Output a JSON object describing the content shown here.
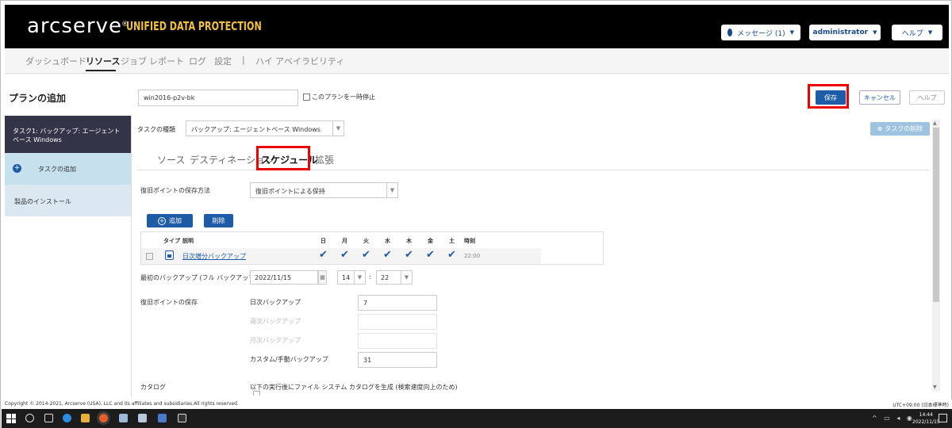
{
  "header": {
    "logo": "arcserve",
    "logo_mark": "®",
    "product": "UNIFIED DATA PROTECTION",
    "messages_label": "メッセージ (1)",
    "user_label": "administrator",
    "help_label": "ヘルプ"
  },
  "nav": {
    "items": [
      "ダッシュボード",
      "リソース",
      "ジョブ",
      "レポート",
      "ログ",
      "設定",
      "|",
      "ハイ アベイラビリティ"
    ]
  },
  "plan": {
    "title": "プランの追加",
    "name_value": "win2016-p2v-bk",
    "pause_label": "このプランを一時停止",
    "save_label": "保存",
    "cancel_label": "キャンセル",
    "help_label": "ヘルプ"
  },
  "sidebar": {
    "task_label": "タスク1: バックアップ: エージェントベース Windows",
    "add_task_label": "タスクの追加",
    "install_label": "製品のインストール"
  },
  "task_type": {
    "label": "タスクの種類",
    "value": "バックアップ: エージェントベース Windows",
    "delete_label": "タスクの削除"
  },
  "tabs": [
    "ソース",
    "デスティネーション",
    "スケジュール",
    "拡張"
  ],
  "form": {
    "retention_method_label": "復旧ポイントの保存方法",
    "retention_method_value": "復旧ポイントによる保持",
    "add_label": "追加",
    "delete_label": "削除",
    "first_backup_label": "最初のバックアップ (フル バックアップ)",
    "first_backup_date": "2022/11/15",
    "first_backup_hour": "14",
    "time_separator": ":",
    "first_backup_minute": "22",
    "retention_label": "復旧ポイントの保存",
    "daily_label": "日次バックアップ",
    "daily_value": "7",
    "weekly_label": "週次バックアップ",
    "monthly_label": "月次バックアップ",
    "custom_label": "カスタム/手動バックアップ",
    "custom_value": "31",
    "catalog_label": "カタログ",
    "catalog_text": "以下の実行後にファイル システム カタログを生成 (検索速度向上のため)"
  },
  "schedule": {
    "headers": {
      "type": "タイプ",
      "desc": "説明",
      "days": [
        "日",
        "月",
        "火",
        "水",
        "木",
        "金",
        "土"
      ],
      "time": "時刻"
    },
    "row": {
      "desc": "日次増分バックアップ",
      "days_checked": [
        true,
        true,
        true,
        true,
        true,
        true,
        true
      ],
      "time": "22:00"
    }
  },
  "footer": {
    "copyright": "Copyright © 2014-2021, Arcserve (USA), LLC and its affiliates and subsidiaries.All rights reserved.",
    "timezone": "UTC+09:00 (日本標準時)"
  },
  "taskbar": {
    "time": "14:44",
    "date": "2022/11/15"
  },
  "colors": {
    "accent": "#1f5ca8",
    "highlight": "#ee0000",
    "header_bg": "#000000",
    "logo_product": "#f0c23a"
  }
}
